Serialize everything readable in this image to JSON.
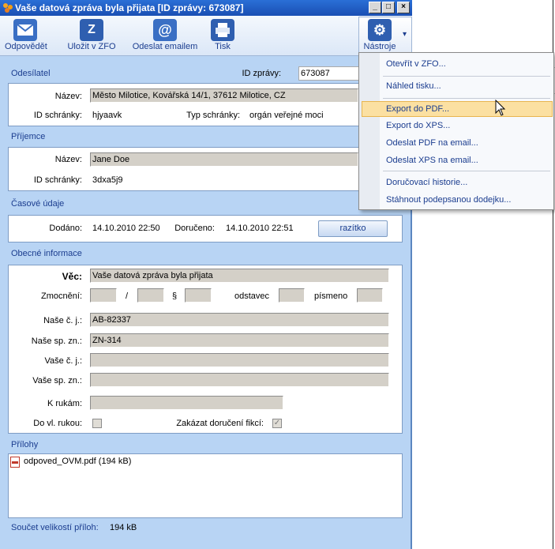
{
  "window": {
    "title": "Vaše datová zpráva byla přijata [ID zprávy: 673087]",
    "btn_min": "_",
    "btn_max": "□",
    "btn_close": "×"
  },
  "toolbar": {
    "reply": "Odpovědět",
    "save_zfo": "Uložit v ZFO",
    "send_email": "Odeslat emailem",
    "print": "Tisk",
    "tools": "Nástroje",
    "tools_arrow": "▾"
  },
  "sender": {
    "section": "Odesílatel",
    "msg_id_label": "ID zprávy:",
    "msg_id": "673087",
    "name_label": "Název:",
    "name": "Město Milotice, Kovářská 14/1, 37612 Milotice, CZ",
    "box_id_label": "ID schránky:",
    "box_id": "hjyaavk",
    "box_type_label": "Typ schránky:",
    "box_type": "orgán veřejné moci"
  },
  "recipient": {
    "section": "Příjemce",
    "name_label": "Název:",
    "name": "Jane Doe",
    "box_id_label": "ID schránky:",
    "box_id": "3dxa5j9"
  },
  "time": {
    "section": "Časové údaje",
    "delivered_label": "Dodáno:",
    "delivered": "14.10.2010 22:50",
    "received_label": "Doručeno:",
    "received": "14.10.2010 22:51",
    "stamp_button": "razítko"
  },
  "general": {
    "section": "Obecné informace",
    "subject_label": "Věc:",
    "subject": "Vaše datová zpráva byla přijata",
    "authorization_label": "Zmocnění:",
    "slash": "/",
    "paragraph": "§",
    "odstavec": "odstavec",
    "pismeno": "písmeno",
    "our_ref_label": "Naše č. j.:",
    "our_ref": "AB-82337",
    "our_file_label": "Naše sp. zn.:",
    "our_file": "ZN-314",
    "your_ref_label": "Vaše č. j.:",
    "your_ref": "",
    "your_file_label": "Vaše sp. zn.:",
    "your_file": "",
    "attention_label": "K rukám:",
    "attention": "",
    "personal_label": "Do vl. rukou:",
    "forbid_fiction_label": "Zakázat doručení fikcí:",
    "forbid_fiction_check": "✓"
  },
  "attachments": {
    "section": "Přílohy",
    "files": [
      {
        "name": "odpoved_OVM.pdf (194 kB)"
      }
    ],
    "total_label": "Součet velikostí příloh:",
    "total": "194 kB"
  },
  "menu": {
    "items": [
      {
        "label": "Otevřít v ZFO..."
      },
      {
        "label": "Náhled tisku..."
      },
      {
        "label": "Export do PDF..."
      },
      {
        "label": "Export do XPS..."
      },
      {
        "label": "Odeslat PDF na email..."
      },
      {
        "label": "Odeslat XPS na email..."
      },
      {
        "label": "Doručovací historie..."
      },
      {
        "label": "Stáhnout podepsanou dodejku..."
      }
    ]
  },
  "icons": {
    "app": "app-logo-icon",
    "reply": "envelope-reply-icon",
    "save": "zfo-file-icon",
    "email": "at-sign-icon",
    "print": "printer-icon",
    "tools": "gear-icon",
    "pdf": "pdf-file-icon",
    "cursor": "mouse-pointer-icon"
  },
  "colors": {
    "titlebar": "#1a4fb3",
    "window_bg": "#b8d4f4",
    "section_text": "#1b3d8f",
    "menu_highlight": "#fbe0a2"
  }
}
